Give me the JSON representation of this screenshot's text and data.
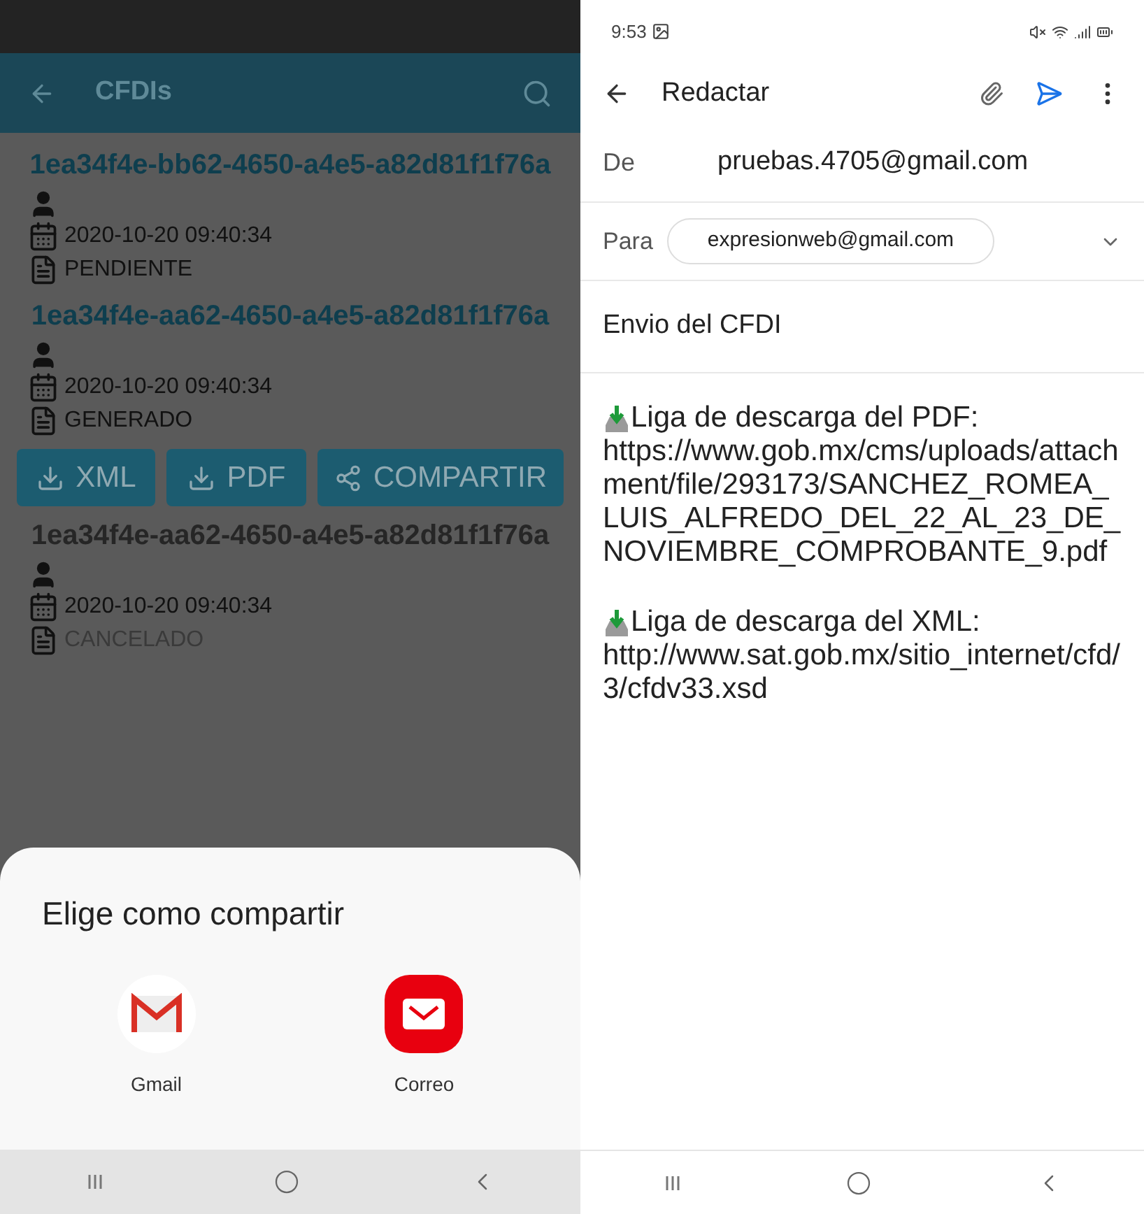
{
  "list_screen": {
    "title": "CFDIs",
    "items": [
      {
        "id": "1ea34f4e-bb62-4650-a4e5-a82d81f1f76a",
        "date": "2020-10-20 09:40:34",
        "status": "PENDIENTE",
        "disabled": false
      },
      {
        "id": "1ea34f4e-aa62-4650-a4e5-a82d81f1f76a",
        "date": "2020-10-20 09:40:34",
        "status": "GENERADO",
        "disabled": false,
        "actions": [
          {
            "kind": "download",
            "label": "XML"
          },
          {
            "kind": "download",
            "label": "PDF"
          },
          {
            "kind": "share",
            "label": "COMPARTIR"
          }
        ]
      },
      {
        "id": "1ea34f4e-aa62-4650-a4e5-a82d81f1f76a",
        "date": "2020-10-20 09:40:34",
        "status": "CANCELADO",
        "disabled": true
      }
    ],
    "share_sheet": {
      "title": "Elige como compartir",
      "apps": [
        {
          "kind": "gmail",
          "label": "Gmail"
        },
        {
          "kind": "mail",
          "label": "Correo"
        }
      ]
    }
  },
  "compose_screen": {
    "status_time": "9:53",
    "title": "Redactar",
    "from_label": "De",
    "from": "pruebas.4705@gmail.com",
    "to_label": "Para",
    "to": "expresionweb@gmail.com",
    "subject": "Envio del CFDI",
    "paragraphs": [
      {
        "label": "Liga de descarga del PDF:",
        "url": "https://www.gob.mx/cms/uploads/attachment/file/293173/SANCHEZ_ROMEA_LUIS_ALFREDO_DEL_22_AL_23_DE_NOVIEMBRE_COMPROBANTE_9.pdf"
      },
      {
        "label": "Liga de descarga del XML:",
        "url": "http://www.sat.gob.mx/sitio_internet/cfd/3/cfdv33.xsd"
      }
    ]
  }
}
